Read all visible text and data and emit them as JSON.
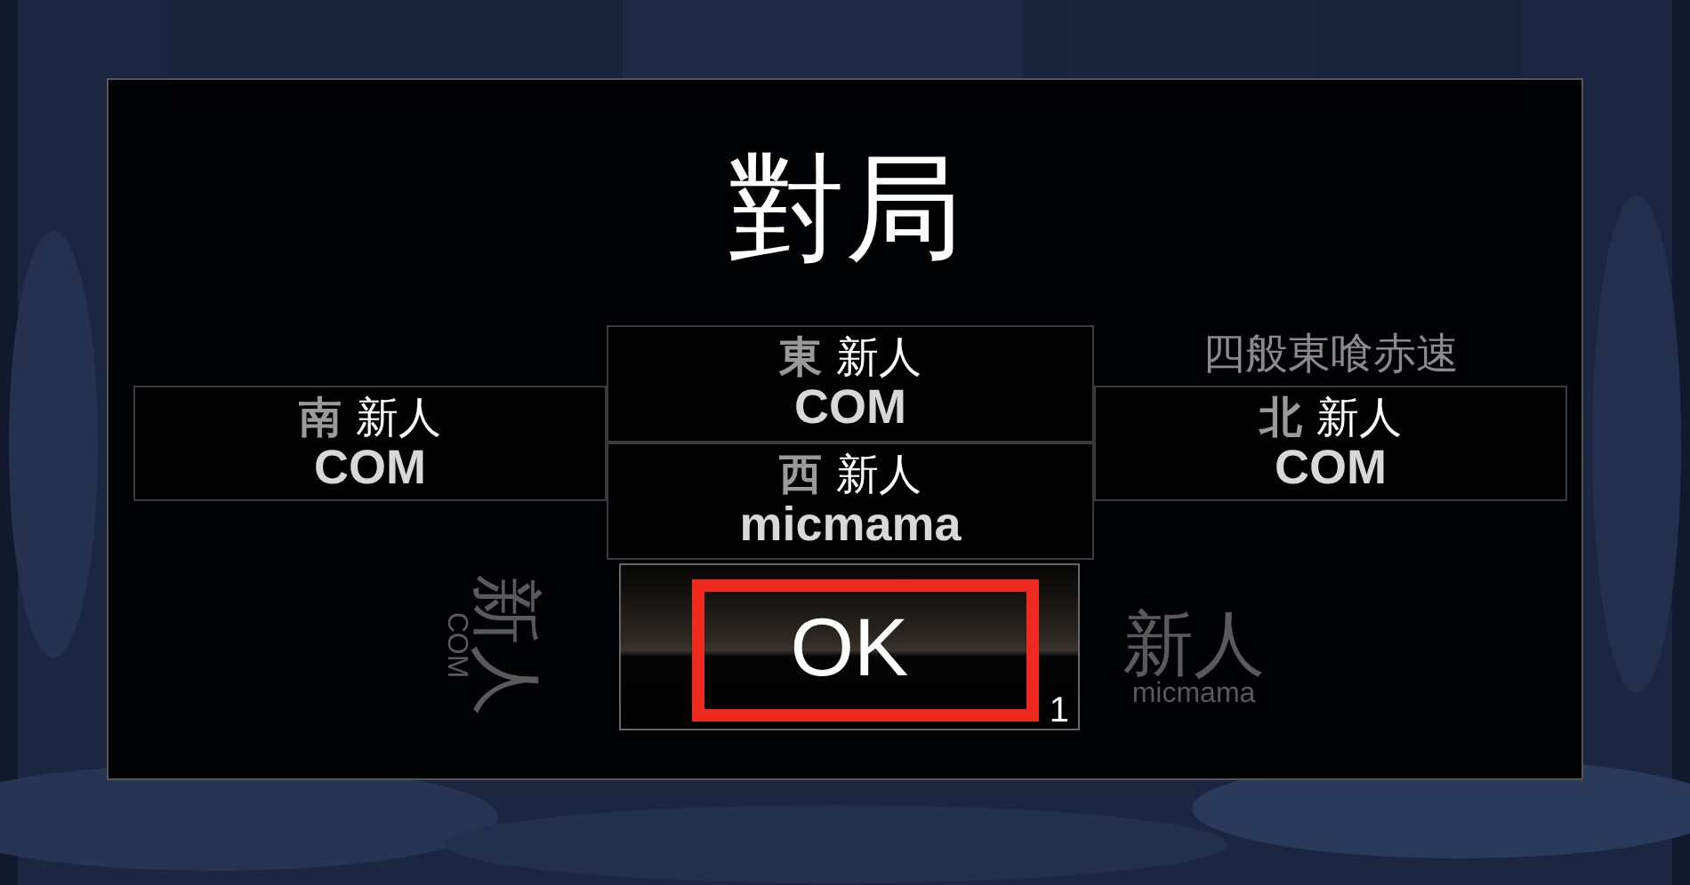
{
  "background_labels": [
    {
      "kind": "left",
      "rank": "新人",
      "name": "COM"
    },
    {
      "kind": "bottom",
      "rank": "新人",
      "name": "micmama"
    }
  ],
  "dialog": {
    "title": "對局",
    "rule_label": "四般東喰赤速",
    "seats": [
      {
        "kind": "south",
        "wind": "南",
        "rank": "新人",
        "name": "COM"
      },
      {
        "kind": "east",
        "wind": "東",
        "rank": "新人",
        "name": "COM"
      },
      {
        "kind": "west",
        "wind": "西",
        "rank": "新人",
        "name": "micmama"
      },
      {
        "kind": "north",
        "wind": "北",
        "rank": "新人",
        "name": "COM"
      }
    ],
    "ok_button": {
      "label": "OK",
      "badge": "1",
      "highlighted": true
    }
  }
}
